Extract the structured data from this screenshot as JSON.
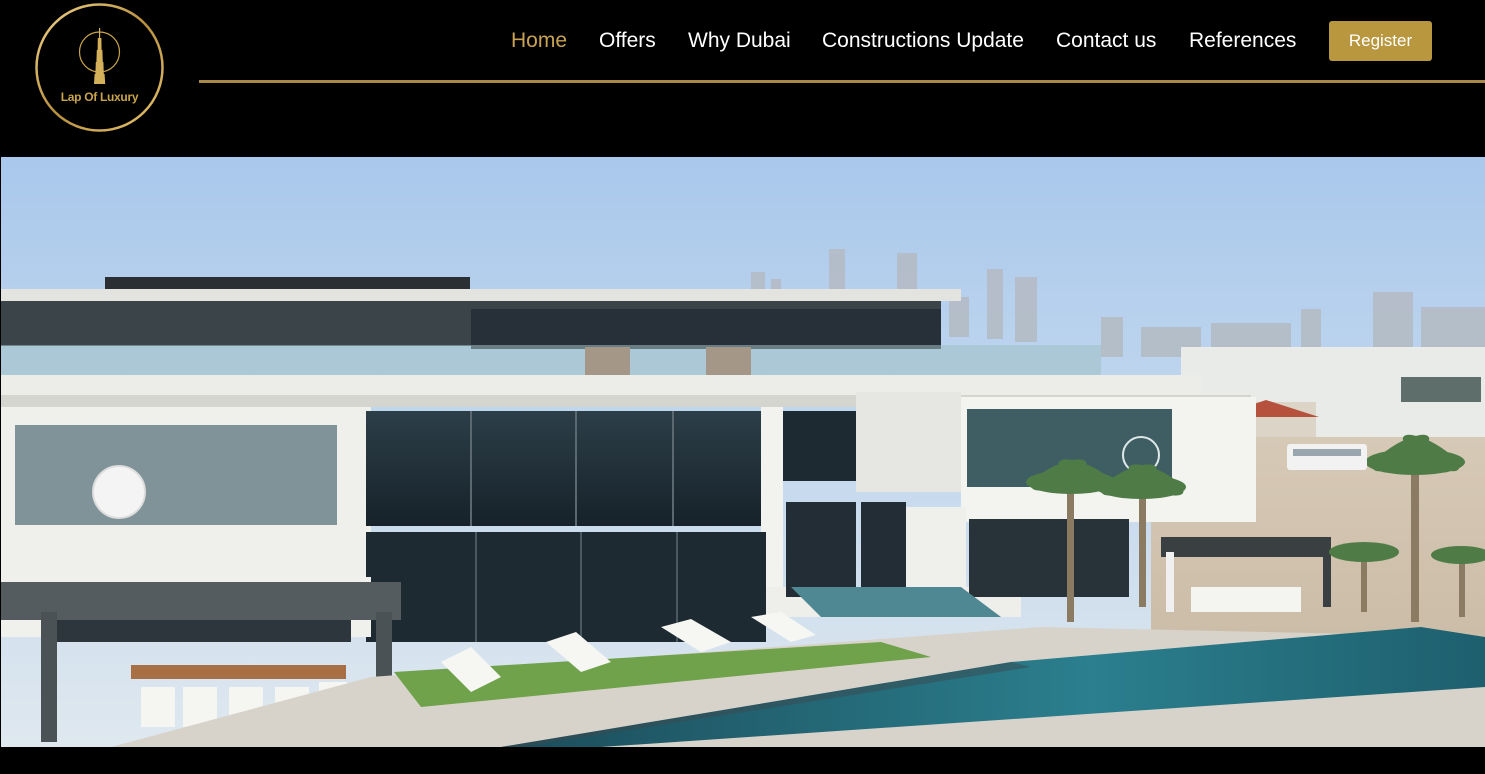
{
  "brand": {
    "name": "Lap Of Luxury",
    "logo_icon": "tower-icon",
    "gold": "#c9a253"
  },
  "nav": {
    "items": [
      {
        "label": "Home",
        "active": true
      },
      {
        "label": "Offers",
        "active": false
      },
      {
        "label": "Why Dubai",
        "active": false
      },
      {
        "label": "Constructions Update",
        "active": false
      },
      {
        "label": "Contact us",
        "active": false
      },
      {
        "label": "References",
        "active": false
      }
    ],
    "register_label": "Register",
    "register_color": "#b9973f"
  }
}
